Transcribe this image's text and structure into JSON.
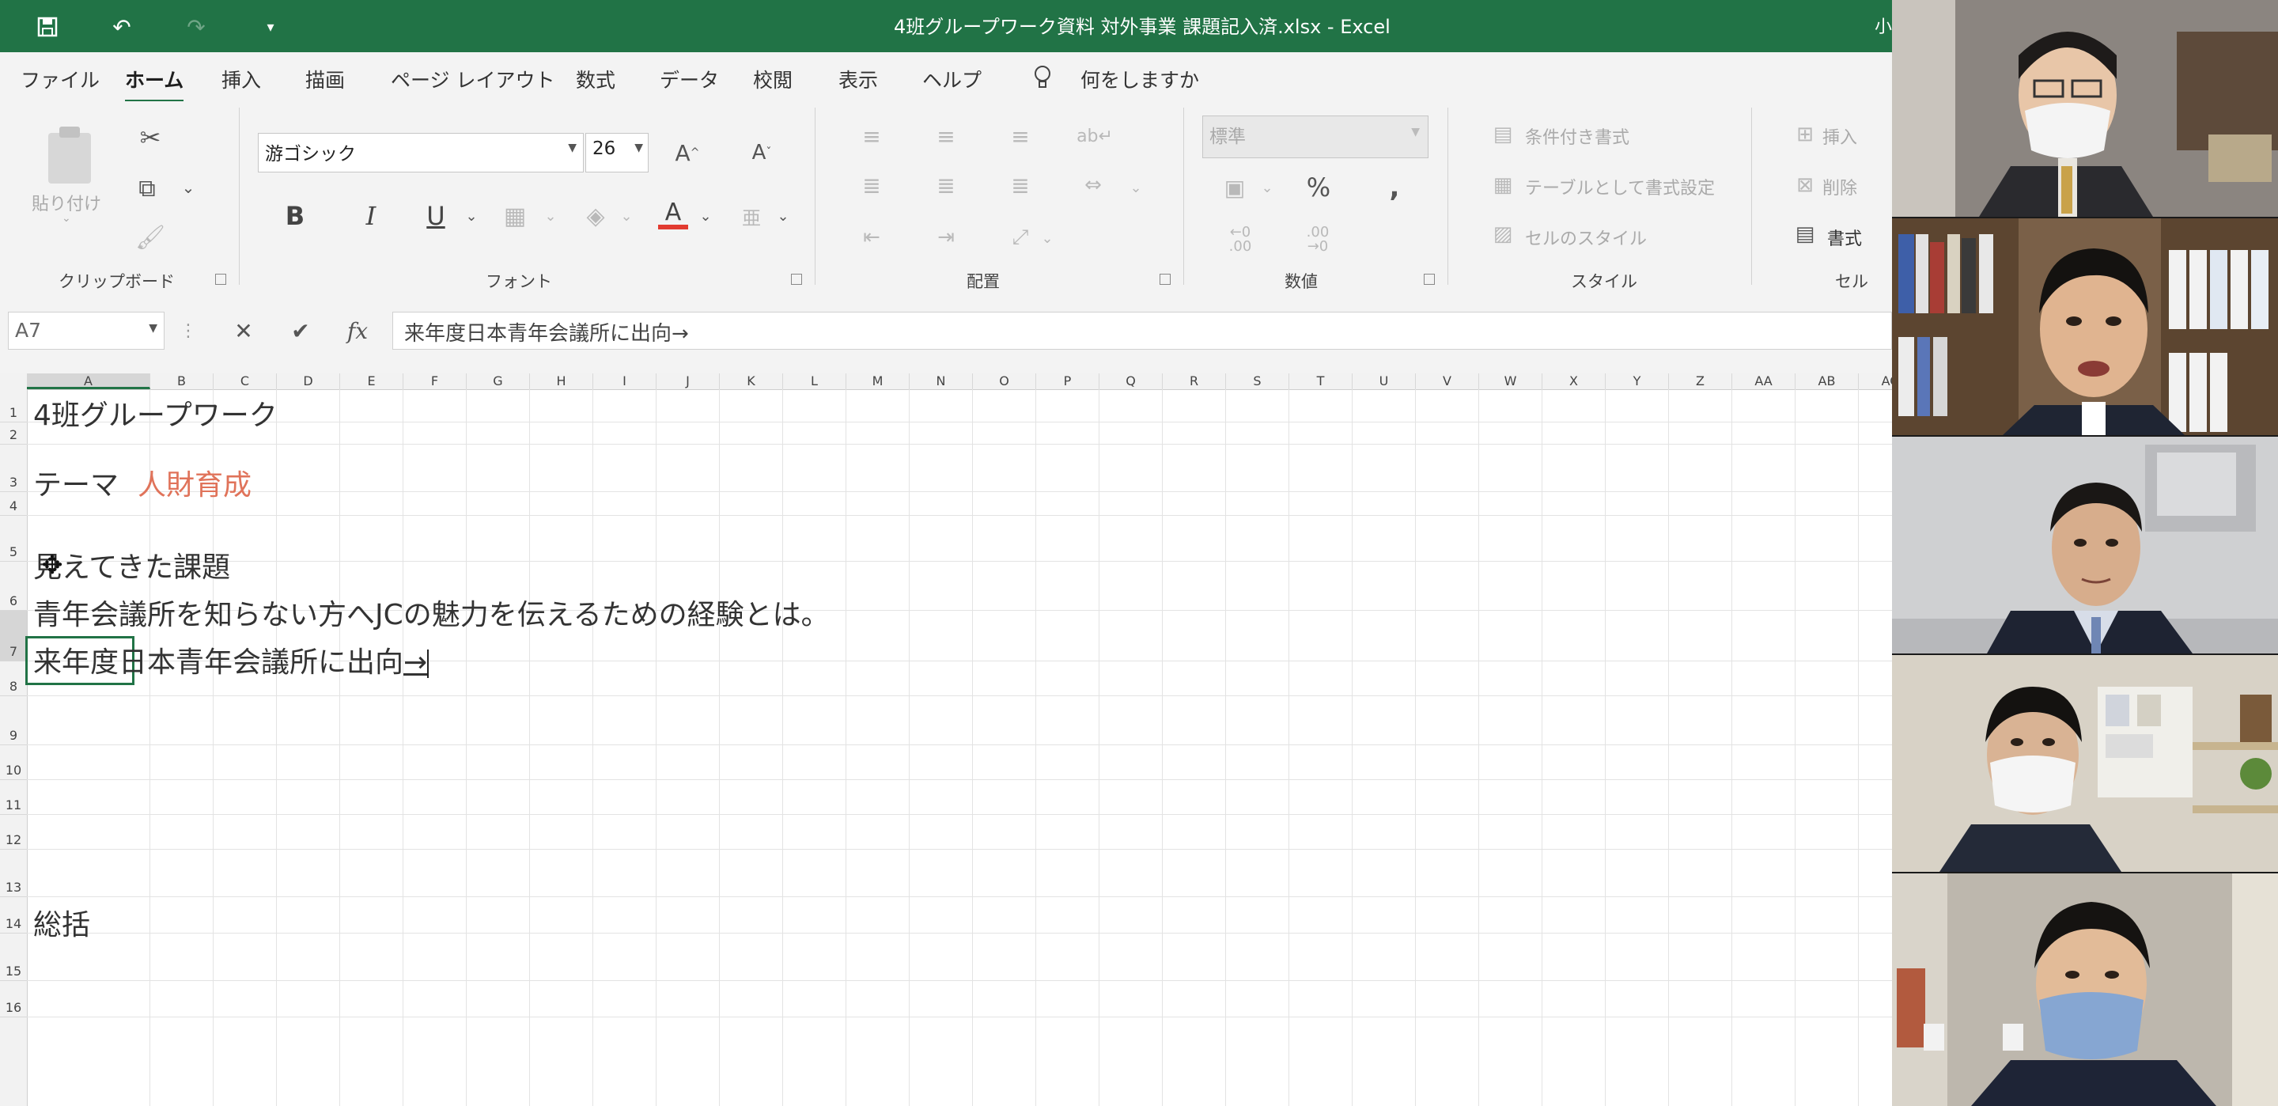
{
  "titlebar": {
    "title": "4班グループワーク資料 対外事業  課題記入済.xlsx  -  Excel",
    "user": "小"
  },
  "menu": [
    "ファイル",
    "ホーム",
    "挿入",
    "描画",
    "ページ レイアウト",
    "数式",
    "データ",
    "校閲",
    "表示",
    "ヘルプ"
  ],
  "tellme": "何をしますか",
  "ribbon": {
    "clipboard": {
      "paste": "貼り付け",
      "label": "クリップボード"
    },
    "font": {
      "name": "游ゴシック",
      "size": "26",
      "label": "フォント"
    },
    "alignment": {
      "label": "配置"
    },
    "number": {
      "format": "標準",
      "label": "数値"
    },
    "styles": {
      "conditional": "条件付き書式",
      "table": "テーブルとして書式設定",
      "cell": "セルのスタイル",
      "label": "スタイル"
    },
    "cells": {
      "insert": "挿入",
      "delete": "削除",
      "format": "書式",
      "label": "セル"
    }
  },
  "formula": {
    "namebox": "A7",
    "value": "来年度日本青年会議所に出向→"
  },
  "columns": [
    "A",
    "B",
    "C",
    "D",
    "E",
    "F",
    "G",
    "H",
    "I",
    "J",
    "K",
    "L",
    "M",
    "N",
    "O",
    "P",
    "Q",
    "R",
    "S",
    "T",
    "U",
    "V",
    "W",
    "X",
    "Y",
    "Z",
    "AA",
    "AB",
    "AC"
  ],
  "rows": [
    "1",
    "2",
    "3",
    "4",
    "5",
    "6",
    "7",
    "8",
    "9",
    "10",
    "11",
    "12",
    "13",
    "14",
    "15",
    "16"
  ],
  "cells": {
    "a1": "4班グループワーク",
    "a3": "テーマ",
    "b3": "人財育成",
    "a5": "見えてきた課題",
    "a6": "青年会議所を知らない方へJCの魅力を伝えるための経験とは。",
    "a7": "来年度日本青年会議所に出向",
    "a7_arrow": "→",
    "a13": "総括"
  },
  "colors": {
    "excel_green": "#217346",
    "accent_red": "#e0735a"
  }
}
